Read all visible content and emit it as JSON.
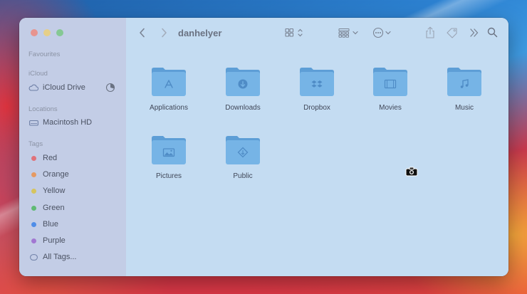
{
  "window": {
    "title": "danhelyer"
  },
  "sidebar": {
    "favourites_header": "Favourites",
    "icloud_header": "iCloud",
    "icloud_drive": "iCloud Drive",
    "locations_header": "Locations",
    "macintosh_hd": "Macintosh HD",
    "tags_header": "Tags",
    "tags": [
      {
        "label": "Red",
        "color": "#e0727a"
      },
      {
        "label": "Orange",
        "color": "#e59a63"
      },
      {
        "label": "Yellow",
        "color": "#d6c45e"
      },
      {
        "label": "Green",
        "color": "#5fba74"
      },
      {
        "label": "Blue",
        "color": "#4f8de8"
      },
      {
        "label": "Purple",
        "color": "#a278d2"
      }
    ],
    "all_tags": "All Tags..."
  },
  "folders": [
    {
      "label": "Applications",
      "icon": "applications-glyph"
    },
    {
      "label": "Downloads",
      "icon": "download-glyph"
    },
    {
      "label": "Dropbox",
      "icon": "dropbox-glyph"
    },
    {
      "label": "Movies",
      "icon": "film-glyph"
    },
    {
      "label": "Music",
      "icon": "music-note-glyph"
    },
    {
      "label": "Pictures",
      "icon": "photo-glyph"
    },
    {
      "label": "Public",
      "icon": "public-glyph"
    }
  ],
  "colors": {
    "folder": "#76b4e6",
    "folder_dark": "#5d9ed6",
    "folder_glyph": "#4f8cc6"
  }
}
